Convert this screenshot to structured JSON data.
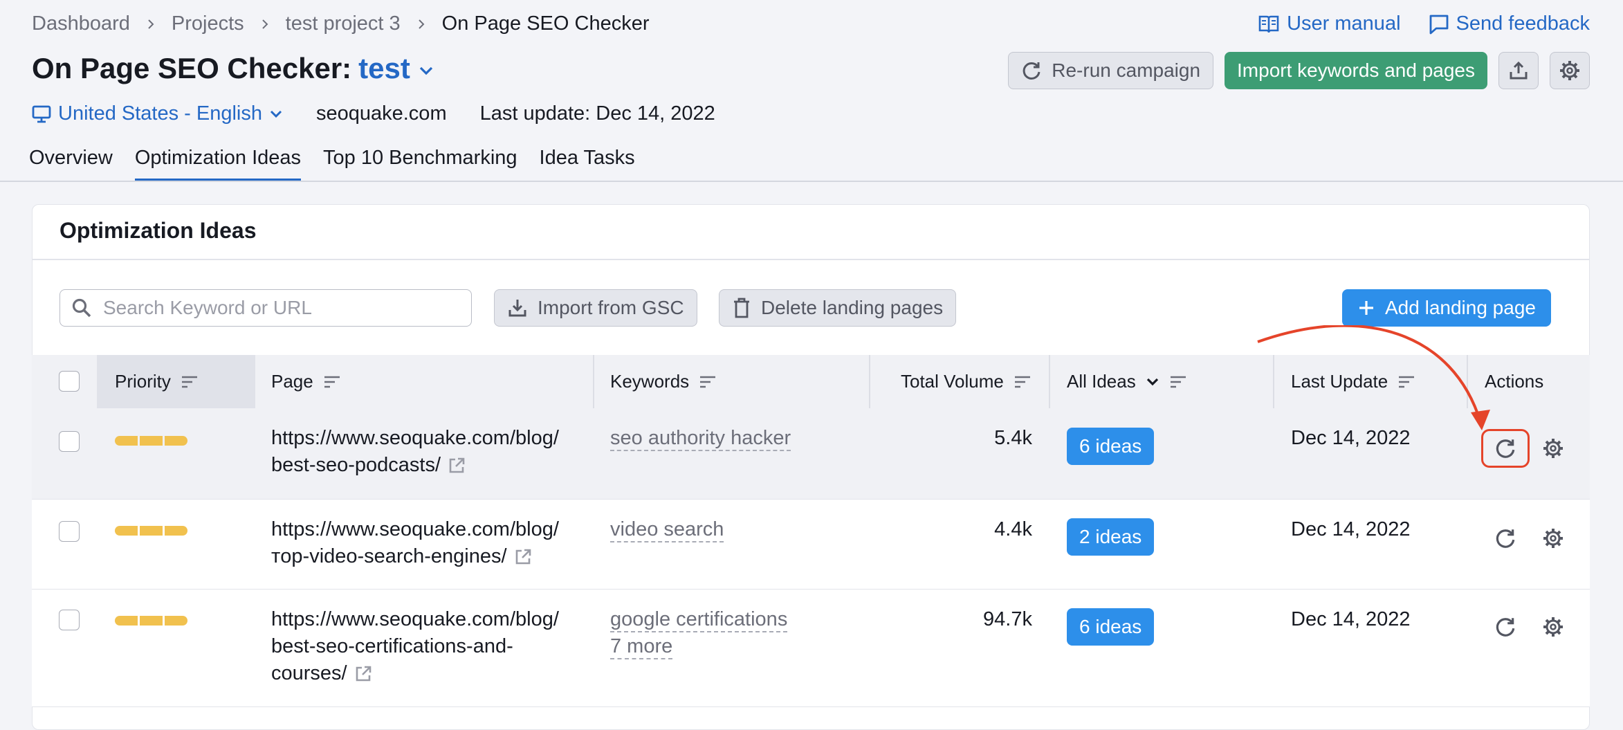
{
  "breadcrumb": [
    "Dashboard",
    "Projects",
    "test project 3",
    "On Page SEO Checker"
  ],
  "header_links": {
    "manual": "User manual",
    "feedback": "Send feedback"
  },
  "title": {
    "tool": "On Page SEO Checker:",
    "project": "test"
  },
  "actions": {
    "rerun": "Re-run campaign",
    "import": "Import keywords and pages"
  },
  "meta": {
    "database": "United States - English",
    "domain": "seoquake.com",
    "last_update": "Last update: Dec 14, 2022"
  },
  "tabs": [
    "Overview",
    "Optimization Ideas",
    "Top 10 Benchmarking",
    "Idea Tasks"
  ],
  "active_tab": "Optimization Ideas",
  "card": {
    "title": "Optimization Ideas",
    "search_placeholder": "Search Keyword or URL",
    "import_gsc": "Import from GSC",
    "delete_pages": "Delete landing pages",
    "add_page": "Add landing page"
  },
  "table": {
    "headers": {
      "priority": "Priority",
      "page": "Page",
      "keywords": "Keywords",
      "volume": "Total Volume",
      "ideas": "All Ideas",
      "updated": "Last Update",
      "actions": "Actions"
    },
    "rows": [
      {
        "url1": "https://www.seoquake.com/blog/",
        "url2": "best-seo-podcasts/",
        "url3": "",
        "keyword": "seo authority hacker",
        "more": "",
        "volume": "5.4k",
        "ideas": "6 ideas",
        "updated": "Dec 14, 2022",
        "priority_level": 3
      },
      {
        "url1": "https://www.seoquake.com/blog/",
        "url2": "тop-video-search-engines/",
        "url3": "",
        "keyword": "video search",
        "more": "",
        "volume": "4.4k",
        "ideas": "2 ideas",
        "updated": "Dec 14, 2022",
        "priority_level": 3
      },
      {
        "url1": "https://www.seoquake.com/blog/",
        "url2": "best-seo-certifications-and-",
        "url3": "courses/",
        "keyword": "google certifications",
        "more": "7 more",
        "volume": "94.7k",
        "ideas": "6 ideas",
        "updated": "Dec 14, 2022",
        "priority_level": 3
      }
    ]
  },
  "colors": {
    "accent": "#2468c5",
    "green": "#3d9d74",
    "button_blue": "#2d8fea",
    "priority": "#f1c14e",
    "annotation": "#e5442a"
  }
}
